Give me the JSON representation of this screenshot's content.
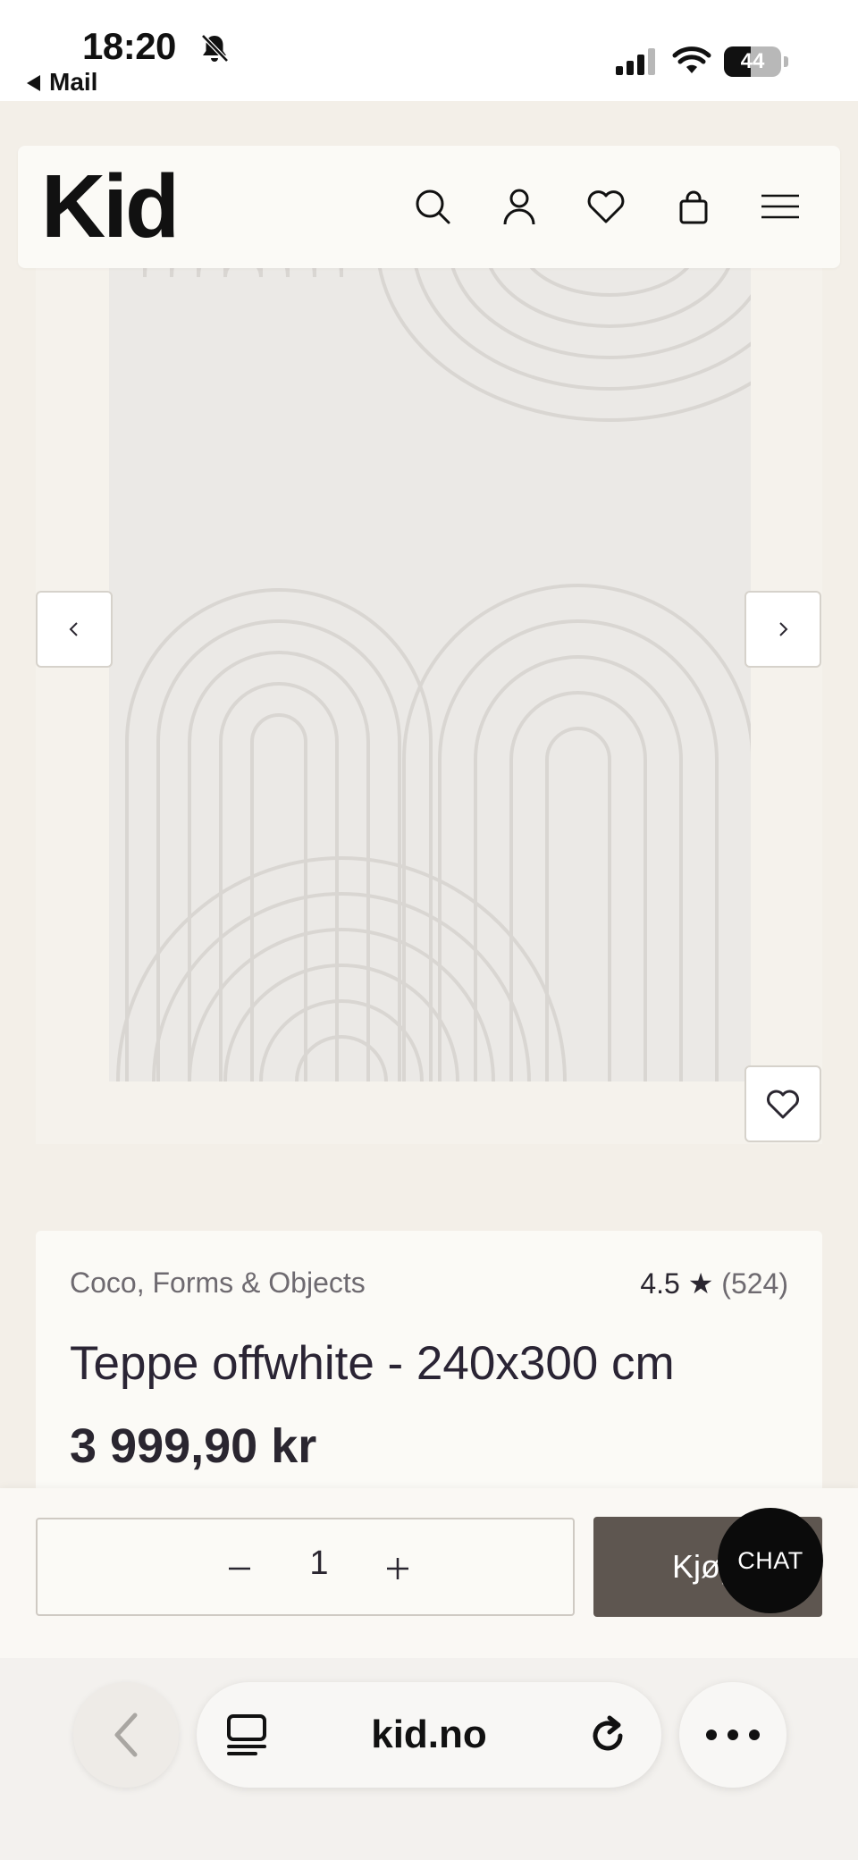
{
  "status_bar": {
    "time": "18:20",
    "back_label": "Mail",
    "battery": "44"
  },
  "header": {
    "logo": "Kid",
    "icons": [
      "search-icon",
      "account-icon",
      "wishlist-icon",
      "cart-icon",
      "menu-icon"
    ]
  },
  "gallery": {
    "prev_icon": "‹",
    "next_icon": "›"
  },
  "product": {
    "brand": "Coco, Forms & Objects",
    "rating": "4.5",
    "rating_star": "★",
    "rating_count": "(524)",
    "title": "Teppe offwhite - 240x300 cm",
    "price": "3 999,90 kr"
  },
  "purchase": {
    "quantity": "1",
    "minus": "–",
    "plus": "+",
    "buy_label": "Kjøp",
    "chat_label": "CHAT"
  },
  "browser": {
    "domain": "kid.no"
  },
  "colors": {
    "page_bg": "#f3efe8",
    "card_bg": "#fbfaf6",
    "buy_button": "#5e5650",
    "chat_button": "#0b0b0b"
  }
}
